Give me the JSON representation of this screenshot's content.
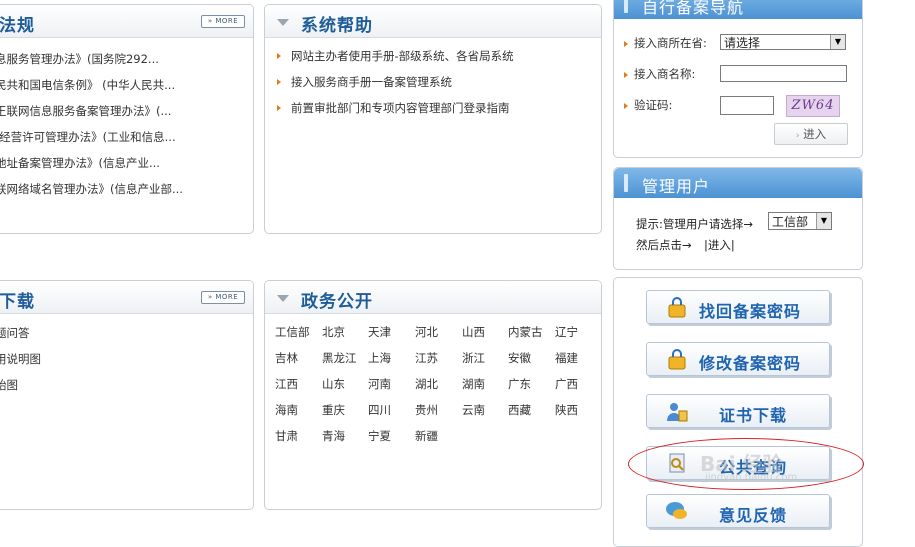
{
  "laws": {
    "title": "法规",
    "more_label": "» MORE",
    "items": [
      "息服务管理办法》(国务院292...",
      "民共和国电信条例》 (中华人民共...",
      "王联网信息服务备案管理办法》(...",
      "-经营许可管理办法》(工业和信息...",
      "地址备案管理办法》(信息产业...",
      "联网络域名管理办法》(信息产业部..."
    ]
  },
  "help": {
    "title": "系统帮助",
    "items": [
      "网站主办者使用手册-部级系统、各省局系统",
      "接入服务商手册一备案管理系统",
      "前置审批部门和专项内容管理部门登录指南"
    ]
  },
  "downloads": {
    "title": "下载",
    "more_label": "» MORE",
    "items": [
      "题问答",
      "用说明图",
      "始图"
    ]
  },
  "gov": {
    "title": "政务公开",
    "regions": [
      "工信部",
      "北京",
      "天津",
      "河北",
      "山西",
      "内蒙古",
      "辽宁",
      "吉林",
      "黑龙江",
      "上海",
      "江苏",
      "浙江",
      "安徽",
      "福建",
      "江西",
      "山东",
      "河南",
      "湖北",
      "湖南",
      "广东",
      "广西",
      "海南",
      "重庆",
      "四川",
      "贵州",
      "云南",
      "西藏",
      "陕西",
      "甘肃",
      "青海",
      "宁夏",
      "新疆"
    ]
  },
  "self_filing": {
    "title": "自行备案导航",
    "province_label": "接入商所在省:",
    "province_value": "请选择",
    "name_label": "接入商名称:",
    "name_value": "",
    "captcha_label": "验证码:",
    "captcha_value": "",
    "captcha_text": "ZW64",
    "enter_button": "进入"
  },
  "admin": {
    "title": "管理用户",
    "hint_line1": "提示:管理用户请选择→",
    "select_value": "工信部",
    "hint_line2": "然后点击→",
    "enter_link": "|进入|"
  },
  "actions": {
    "retrieve_password": "找回备案密码",
    "change_password": "修改备案密码",
    "certificate_download": "证书下载",
    "public_query": "公共查询",
    "feedback": "意见反馈"
  },
  "watermark": {
    "main": "Bai 经验",
    "sub": "jingyan.baidu.com"
  },
  "colors": {
    "title_blue": "#1e5d99",
    "accent_orange": "#e07a1a",
    "highlight_red": "#d32626",
    "header_blue": "#4c92d3"
  }
}
